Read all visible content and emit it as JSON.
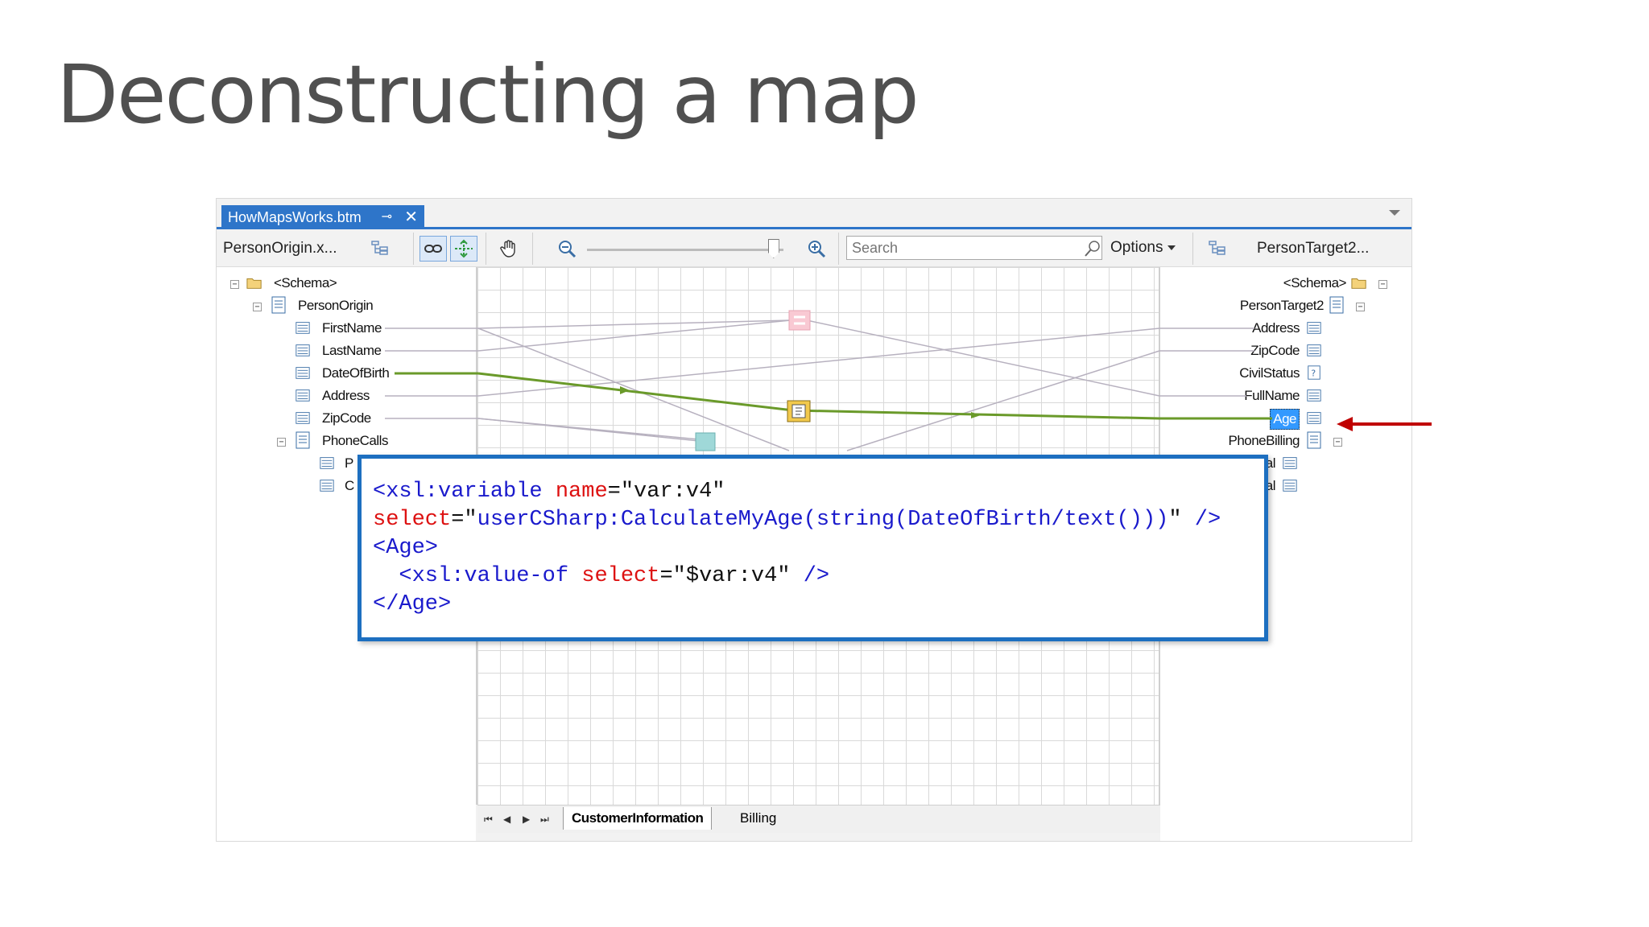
{
  "slide": {
    "title": "Deconstructing a map"
  },
  "window": {
    "tab_label": "HowMapsWorks.btm",
    "pin_glyph": "⊸",
    "close_glyph": "✕"
  },
  "toolbar": {
    "source_schema": "PersonOrigin.x...",
    "target_schema": "PersonTarget2...",
    "search_placeholder": "Search",
    "options_label": "Options",
    "zoom_level": 0.95
  },
  "source_tree": {
    "root": "<Schema>",
    "record": "PersonOrigin",
    "fields": [
      "FirstName",
      "LastName",
      "DateOfBirth",
      "Address",
      "ZipCode"
    ],
    "child_record": "PhoneCalls",
    "child_fields": [
      "P",
      "C"
    ]
  },
  "target_tree": {
    "root": "<Schema>",
    "record": "PersonTarget2",
    "fields": [
      "Address",
      "ZipCode",
      "CivilStatus",
      "FullName",
      "Age"
    ],
    "child_record": "PhoneBilling",
    "child_fields": [
      "al",
      "al"
    ],
    "selected_field": "Age"
  },
  "page_tabs": {
    "tabs": [
      "CustomerInformation",
      "Billing"
    ],
    "active": "CustomerInformation",
    "nav": [
      "⏮",
      "◀",
      "▶",
      "⏭"
    ]
  },
  "code": {
    "line1": {
      "tag": "<xsl:variable",
      "attr": "name",
      "eq": "=",
      "val": "\"var:v4\""
    },
    "line2": {
      "attr": "select",
      "eq": "=",
      "val": "\"userCSharp:CalculateMyAge(string(DateOfBirth/text()))\"",
      "end": " />"
    },
    "line3": {
      "tag": "<Age>"
    },
    "line4": {
      "tag": "<xsl:value-of",
      "attr": "select",
      "eq": "=",
      "val": "\"$var:v4\"",
      "end": " />"
    },
    "line5": {
      "tag": "</Age>"
    }
  },
  "colors": {
    "accent_blue": "#2e75c9",
    "highlight_link": "#6a9a2a",
    "arrow_red": "#c00000",
    "selected_bg": "#3399ff"
  }
}
